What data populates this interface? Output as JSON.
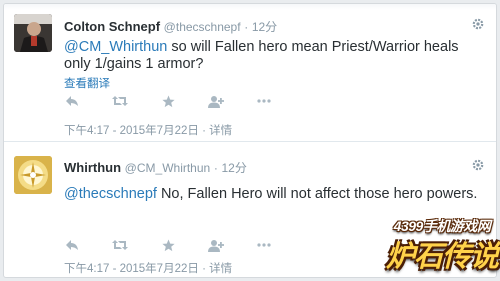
{
  "tweets": [
    {
      "fullname": "Colton Schnepf",
      "handle": "@thecschnepf",
      "dot": "·",
      "time": "12分",
      "mention": "@CM_Whirthun",
      "text": " so will Fallen hero mean Priest/Warrior heals only 1/gains 1 armor?",
      "translate": "查看翻译",
      "meta": "下午4:17 - 2015年7月22日 · 详情",
      "avatar": "user-photo"
    },
    {
      "fullname": "Whirthun",
      "handle": "@CM_Whirthun",
      "dot": "·",
      "time": "12分",
      "mention": "@thecschnepf",
      "text": " No, Fallen Hero will not affect those hero powers.",
      "meta": "下午4:17 - 2015年7月22日 · 详情",
      "avatar": "hearthstone-logo"
    }
  ],
  "icons": [
    "reply-icon",
    "retweet-icon",
    "favorite-icon",
    "follow-icon",
    "more-icon",
    "gear-icon"
  ],
  "watermark": {
    "site": "4399手机游戏网",
    "title": "炉石传说"
  },
  "colors": {
    "link": "#2b7bb9",
    "text": "#292f33",
    "muted": "#8899a6",
    "icon": "#aab8c2"
  }
}
